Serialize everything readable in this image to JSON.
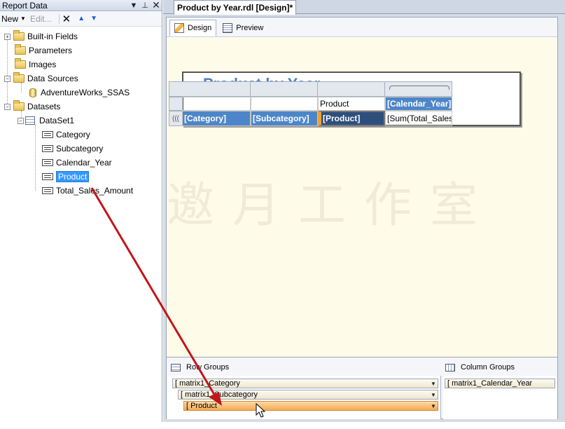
{
  "report_data_pane": {
    "title": "Report Data",
    "toolbar": {
      "new_label": "New",
      "edit_label": "Edit..."
    },
    "tree": [
      {
        "label": "Built-in Fields",
        "type": "folder",
        "expanded": false
      },
      {
        "label": "Parameters",
        "type": "folder"
      },
      {
        "label": "Images",
        "type": "folder"
      },
      {
        "label": "Data Sources",
        "type": "folder",
        "expanded": true
      },
      {
        "label": "AdventureWorks_SSAS",
        "type": "datasource"
      },
      {
        "label": "Datasets",
        "type": "folder",
        "expanded": true
      },
      {
        "label": "DataSet1",
        "type": "dataset",
        "expanded": true
      },
      {
        "label": "Category",
        "type": "field"
      },
      {
        "label": "Subcategory",
        "type": "field"
      },
      {
        "label": "Calendar_Year",
        "type": "field"
      },
      {
        "label": "Product",
        "type": "field",
        "selected": true
      },
      {
        "label": "Total_Sales_Amount",
        "type": "field"
      }
    ]
  },
  "document": {
    "tab_title": "Product by Year.rdl [Design]*",
    "view_tabs": {
      "design": "Design",
      "preview": "Preview"
    },
    "report_title_text": "Product by Year",
    "watermark": "邀月工作室",
    "matrix": {
      "header_product": "Product",
      "header_year": "[Calendar_Year]",
      "cell_category": "[Category]",
      "cell_subcategory": "[Subcategory]",
      "cell_product": "[Product]",
      "cell_sum": "[Sum(Total_Sales_Amount)]",
      "row_handle_glyph": "((("
    },
    "groups": {
      "row_groups_label": "Row Groups",
      "column_groups_label": "Column Groups",
      "row_groups": [
        "matrix1_Category",
        "matrix1_Subcategory",
        "Product"
      ],
      "column_groups": [
        "matrix1_Calendar_Year"
      ]
    }
  },
  "colors": {
    "selection": "#3399ff",
    "accent_blue": "#4d86c8",
    "drag_arrow": "#c0161b",
    "drop_highlight": "#f3aa55"
  }
}
